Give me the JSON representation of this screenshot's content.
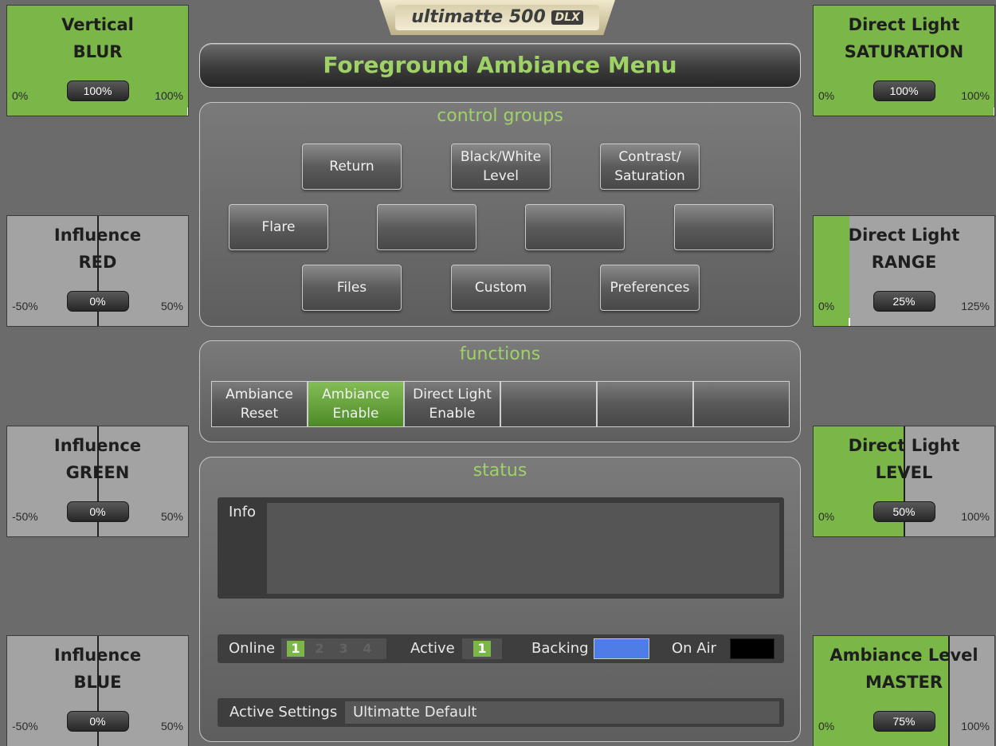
{
  "logo": {
    "text": "ultimatte 500",
    "badge": "DLX"
  },
  "menu_title": "Foreground Ambiance Menu",
  "control_groups": {
    "title": "control groups",
    "buttons": [
      "Return",
      "Black/White\nLevel",
      "Contrast/\nSaturation",
      "Flare",
      "",
      "",
      "",
      "Files",
      "Custom",
      "Preferences"
    ]
  },
  "functions": {
    "title": "functions",
    "buttons": [
      "Ambiance\nReset",
      "Ambiance\nEnable",
      "Direct Light\nEnable",
      "",
      "",
      ""
    ],
    "active_index": 1
  },
  "status": {
    "title": "status",
    "info_label": "Info",
    "online_label": "Online",
    "online_channels": [
      "1",
      "2",
      "3",
      "4"
    ],
    "online_active": 1,
    "active_label": "Active",
    "active_value": "1",
    "backing_label": "Backing",
    "backing_color": "#4f7de8",
    "on_air_label": "On Air",
    "on_air_color": "#000000",
    "settings_label": "Active Settings",
    "settings_value": "Ultimatte Default"
  },
  "knobs_left": [
    {
      "line1": "Vertical",
      "line2": "BLUR",
      "min": "0%",
      "max": "100%",
      "value": "100%",
      "fraction": 1.0
    },
    {
      "line1": "Influence",
      "line2": "RED",
      "min": "-50%",
      "max": "50%",
      "value": "0%",
      "fraction": 0.5
    },
    {
      "line1": "Influence",
      "line2": "GREEN",
      "min": "-50%",
      "max": "50%",
      "value": "0%",
      "fraction": 0.5
    },
    {
      "line1": "Influence",
      "line2": "BLUE",
      "min": "-50%",
      "max": "50%",
      "value": "0%",
      "fraction": 0.5
    }
  ],
  "knobs_right": [
    {
      "line1": "Direct Light",
      "line2": "SATURATION",
      "min": "0%",
      "max": "100%",
      "value": "100%",
      "fraction": 1.0
    },
    {
      "line1": "Direct Light",
      "line2": "RANGE",
      "min": "0%",
      "max": "125%",
      "value": "25%",
      "fraction": 0.2
    },
    {
      "line1": "Direct Light",
      "line2": "LEVEL",
      "min": "0%",
      "max": "100%",
      "value": "50%",
      "fraction": 0.5
    },
    {
      "line1": "Ambiance Level",
      "line2": "MASTER",
      "min": "0%",
      "max": "100%",
      "value": "75%",
      "fraction": 0.75
    }
  ],
  "colors": {
    "accent": "#9fd266",
    "fill": "#7ab648"
  }
}
